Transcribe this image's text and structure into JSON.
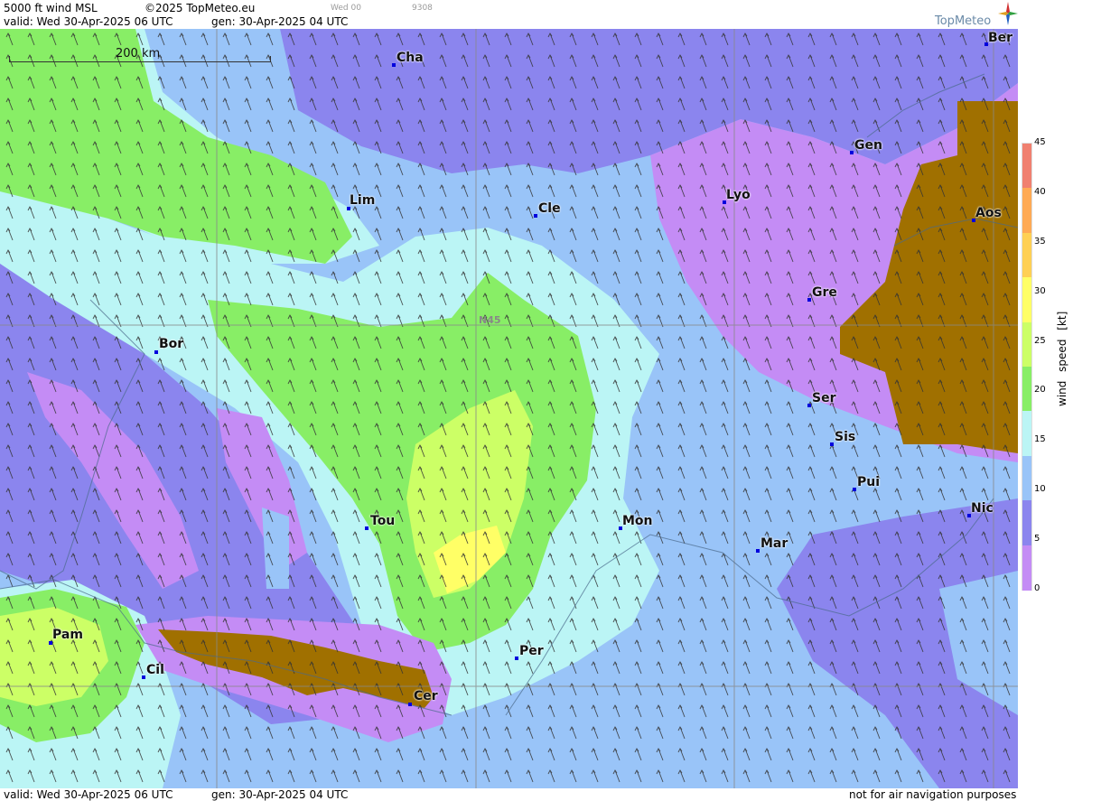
{
  "header": {
    "product": "5000 ft wind MSL",
    "copyright": "©2025 TopMeteo.eu",
    "valid": "valid:  Wed  30-Apr-2025  06 UTC",
    "gen": "gen: 30-Apr-2025 04 UTC",
    "small_day": "Wed 00",
    "small_code": "9308",
    "logo_text": "TopMeteo"
  },
  "scale": {
    "label": "200 km"
  },
  "grid_label": "N45",
  "cities": [
    {
      "name": "Cha",
      "id": "cha"
    },
    {
      "name": "Ber",
      "id": "ber"
    },
    {
      "name": "Gen",
      "id": "gen"
    },
    {
      "name": "Lim",
      "id": "lim"
    },
    {
      "name": "Cle",
      "id": "cle"
    },
    {
      "name": "Lyo",
      "id": "lyo"
    },
    {
      "name": "Aos",
      "id": "aos"
    },
    {
      "name": "Gre",
      "id": "gre"
    },
    {
      "name": "Bor",
      "id": "bor"
    },
    {
      "name": "Ser",
      "id": "ser"
    },
    {
      "name": "Sis",
      "id": "sis"
    },
    {
      "name": "Pui",
      "id": "pui"
    },
    {
      "name": "Tou",
      "id": "tou"
    },
    {
      "name": "Mon",
      "id": "mon"
    },
    {
      "name": "Mar",
      "id": "mar"
    },
    {
      "name": "Nic",
      "id": "nic"
    },
    {
      "name": "Pam",
      "id": "pam"
    },
    {
      "name": "Cil",
      "id": "cil"
    },
    {
      "name": "Per",
      "id": "per"
    },
    {
      "name": "Cer",
      "id": "cer"
    }
  ],
  "legend": {
    "title": "wind speed [kt]",
    "ticks": [
      "45",
      "40",
      "35",
      "30",
      "25",
      "20",
      "15",
      "10",
      "5",
      "0"
    ],
    "colors": [
      "#f08070",
      "#ffaa55",
      "#ffd055",
      "#ffff66",
      "#ccff66",
      "#88ee66",
      "#bbf5f5",
      "#99c4f8",
      "#8b85ee",
      "#c48cf5"
    ]
  },
  "footer": {
    "valid": "valid:  Wed  30-Apr-2025  06 UTC",
    "gen": "gen: 30-Apr-2025 04 UTC",
    "disclaimer": "not for air navigation purposes"
  },
  "map_colors": {
    "light_blue": "#99c4f8",
    "cyan": "#bbf5f5",
    "green": "#88ee66",
    "light_green": "#ccff66",
    "yellow": "#ffff66",
    "purple": "#8b85ee",
    "violet": "#c48cf5",
    "terrain": "#a07000"
  }
}
